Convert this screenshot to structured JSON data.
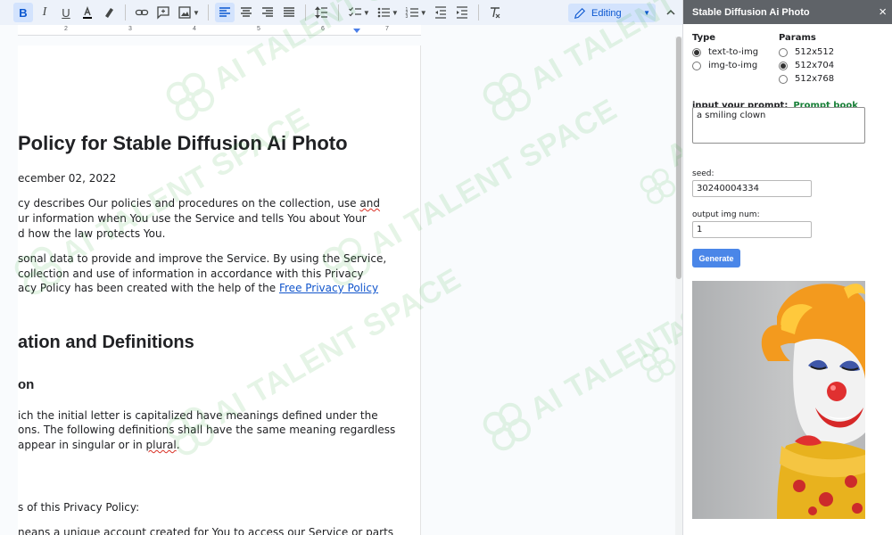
{
  "toolbar": {
    "mode_label": "Editing"
  },
  "ruler": {
    "numbers": [
      "2",
      "3",
      "4",
      "5",
      "6",
      "7"
    ]
  },
  "document": {
    "title": "Policy for Stable Diffusion Ai Photo",
    "date": "ecember 02, 2022",
    "para1": {
      "line1_a": "cy describes Our policies and procedures on the collection, use ",
      "line1_b": "and",
      "line2": "ur information when You use the Service and tells You about Your",
      "line3": "d how the law protects You."
    },
    "para2": {
      "line1": "sonal data to provide and improve the Service. By using the Service,",
      "line2": " collection and use of information in accordance with this Privacy",
      "line3_a": "acy Policy has been created with the help of the ",
      "line3_link": "Free Privacy Policy"
    },
    "heading2": "ation and Definitions",
    "heading3": "on",
    "para3": {
      "line1": "ich the initial letter is capitalized have meanings defined under the",
      "line2": "ons. The following definitions shall have the same meaning regardless",
      "line3_a": " appear in singular or in ",
      "line3_b": "plural",
      "line3_c": "."
    },
    "para4": "s of this Privacy Policy:",
    "para5": "neans a unique account created for You to access our Service or parts"
  },
  "watermark": {
    "text": "AI TALENT SPACE"
  },
  "panel": {
    "title": "Stable Diffusion Ai Photo",
    "close_glyph": "×",
    "type_label": "Type",
    "type_options": [
      "text-to-img",
      "img-to-img"
    ],
    "type_selected": "text-to-img",
    "params_label": "Params",
    "params_options": [
      "512x512",
      "512x704",
      "512x768"
    ],
    "params_selected": "512x704",
    "prompt_label": "input your prompt:",
    "prompt_book": "Prompt book",
    "prompt_value": "a smiling clown",
    "seed_label": "seed:",
    "seed_value": "30240004334",
    "num_label": "output img num:",
    "num_value": "1",
    "generate_label": "Generate"
  },
  "colors": {
    "accent": "#4a86e8",
    "panel_header": "#5f6368",
    "prompt_book": "#188038",
    "watermark": "#3cb043"
  }
}
